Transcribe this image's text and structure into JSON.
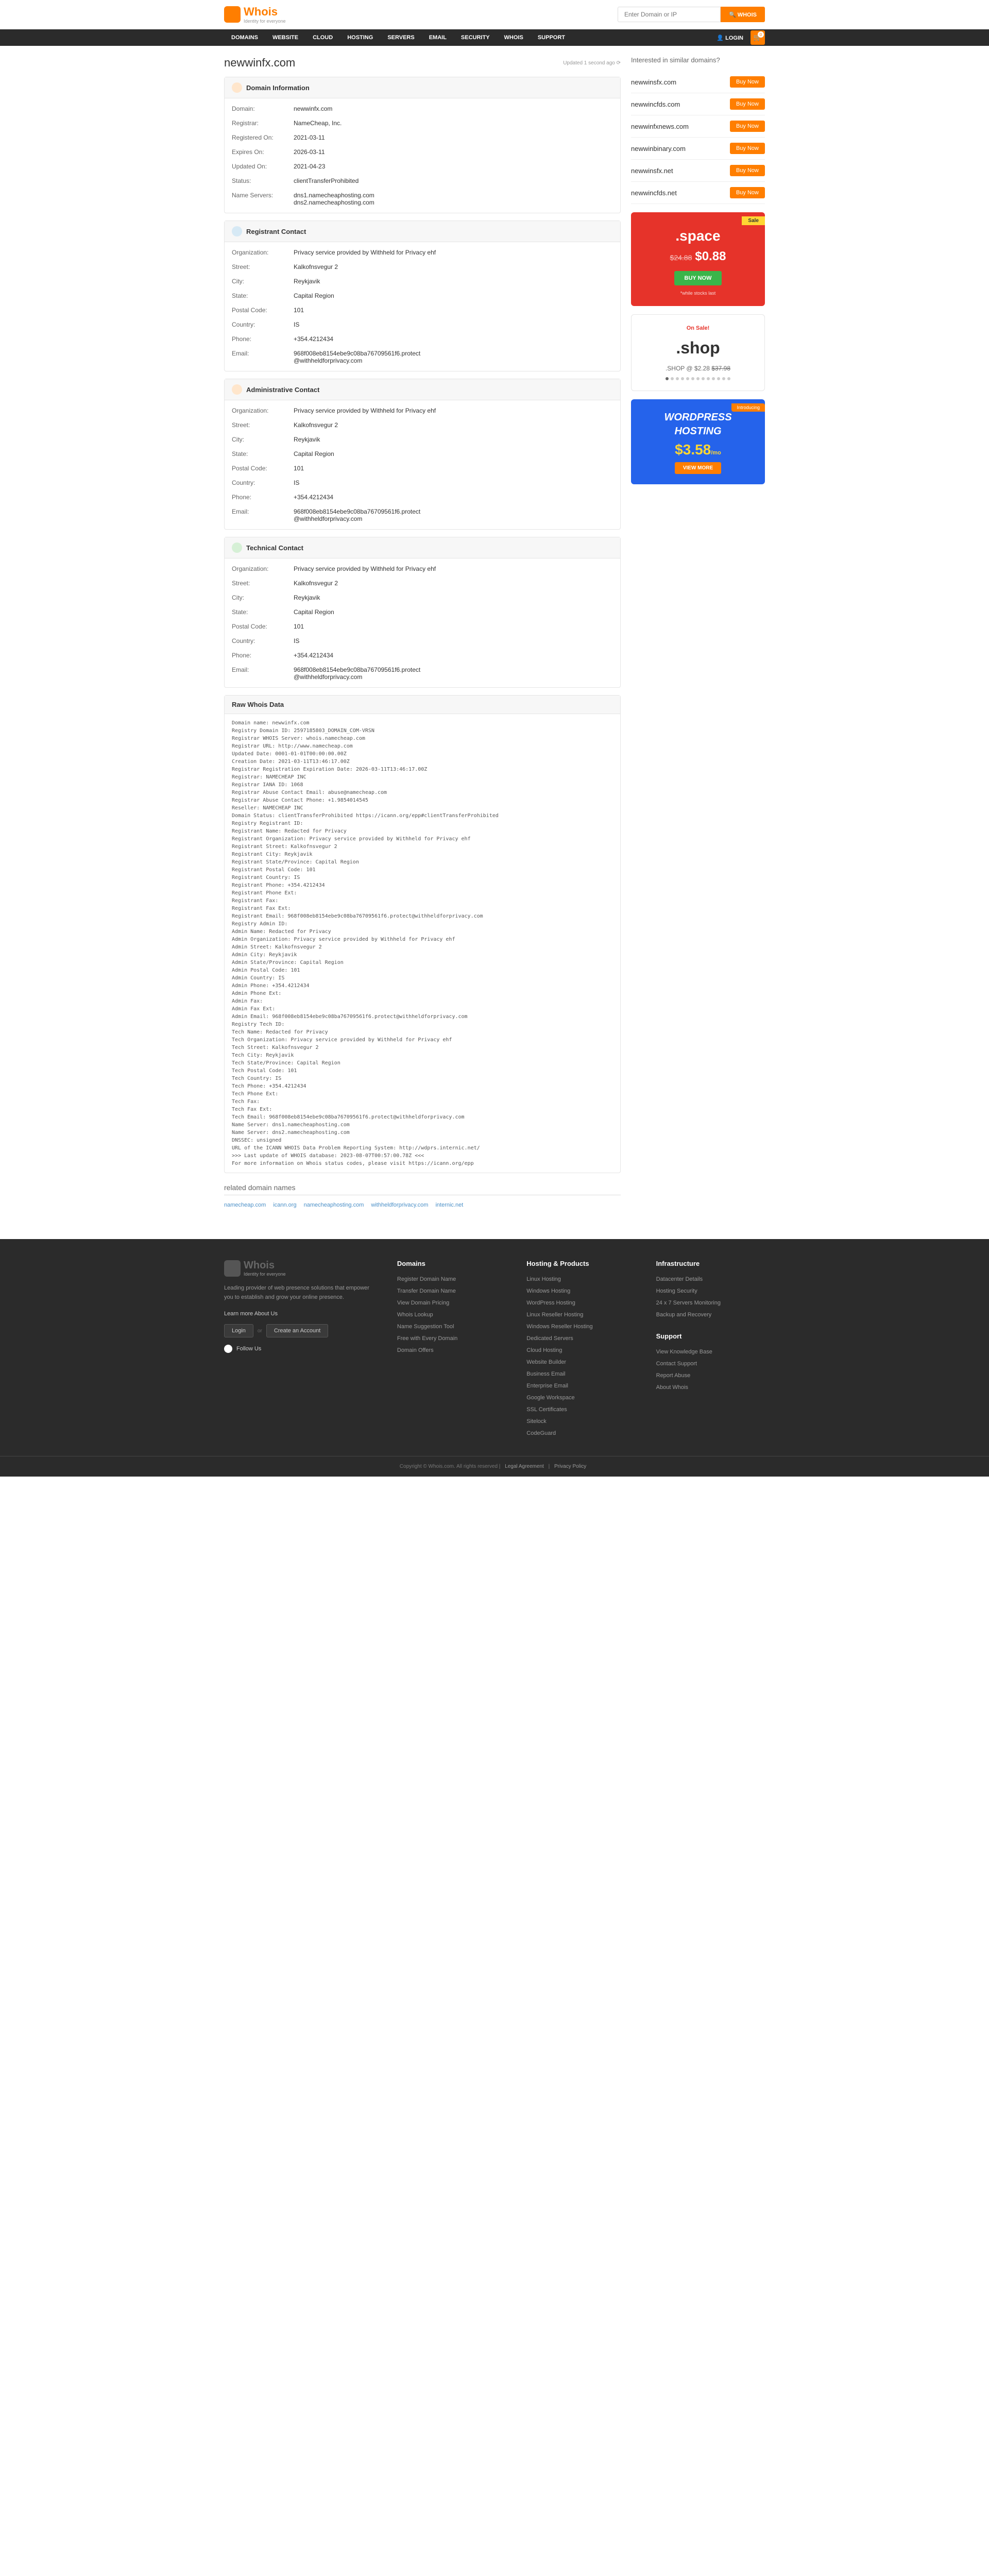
{
  "brand": {
    "name": "Whois",
    "tagline": "Identity for everyone"
  },
  "search": {
    "placeholder": "Enter Domain or IP",
    "button": "🔍 WHOIS"
  },
  "nav": [
    "DOMAINS",
    "WEBSITE",
    "CLOUD",
    "HOSTING",
    "SERVERS",
    "EMAIL",
    "SECURITY",
    "WHOIS",
    "SUPPORT"
  ],
  "login": "LOGIN",
  "cart_count": "0",
  "page_title": "newwinfx.com",
  "updated": "Updated 1 second ago ⟳",
  "sections": {
    "domain_info": {
      "title": "Domain Information",
      "rows": [
        {
          "label": "Domain:",
          "value": "newwinfx.com"
        },
        {
          "label": "Registrar:",
          "value": "NameCheap, Inc."
        },
        {
          "label": "Registered On:",
          "value": "2021-03-11"
        },
        {
          "label": "Expires On:",
          "value": "2026-03-11"
        },
        {
          "label": "Updated On:",
          "value": "2021-04-23"
        },
        {
          "label": "Status:",
          "value": "clientTransferProhibited"
        },
        {
          "label": "Name Servers:",
          "value": "dns1.namecheaphosting.com\ndns2.namecheaphosting.com"
        }
      ]
    },
    "registrant": {
      "title": "Registrant Contact",
      "rows": [
        {
          "label": "Organization:",
          "value": "Privacy service provided by Withheld for Privacy ehf"
        },
        {
          "label": "Street:",
          "value": "Kalkofnsvegur 2"
        },
        {
          "label": "City:",
          "value": "Reykjavik"
        },
        {
          "label": "State:",
          "value": "Capital Region"
        },
        {
          "label": "Postal Code:",
          "value": "101"
        },
        {
          "label": "Country:",
          "value": "IS"
        },
        {
          "label": "Phone:",
          "value": "+354.4212434"
        },
        {
          "label": "Email:",
          "value": "968f008eb8154ebe9c08ba76709561f6.protect\n@withheldforprivacy.com"
        }
      ]
    },
    "admin": {
      "title": "Administrative Contact",
      "rows": [
        {
          "label": "Organization:",
          "value": "Privacy service provided by Withheld for Privacy ehf"
        },
        {
          "label": "Street:",
          "value": "Kalkofnsvegur 2"
        },
        {
          "label": "City:",
          "value": "Reykjavik"
        },
        {
          "label": "State:",
          "value": "Capital Region"
        },
        {
          "label": "Postal Code:",
          "value": "101"
        },
        {
          "label": "Country:",
          "value": "IS"
        },
        {
          "label": "Phone:",
          "value": "+354.4212434"
        },
        {
          "label": "Email:",
          "value": "968f008eb8154ebe9c08ba76709561f6.protect\n@withheldforprivacy.com"
        }
      ]
    },
    "tech": {
      "title": "Technical Contact",
      "rows": [
        {
          "label": "Organization:",
          "value": "Privacy service provided by Withheld for Privacy ehf"
        },
        {
          "label": "Street:",
          "value": "Kalkofnsvegur 2"
        },
        {
          "label": "City:",
          "value": "Reykjavik"
        },
        {
          "label": "State:",
          "value": "Capital Region"
        },
        {
          "label": "Postal Code:",
          "value": "101"
        },
        {
          "label": "Country:",
          "value": "IS"
        },
        {
          "label": "Phone:",
          "value": "+354.4212434"
        },
        {
          "label": "Email:",
          "value": "968f008eb8154ebe9c08ba76709561f6.protect\n@withheldforprivacy.com"
        }
      ]
    },
    "raw": {
      "title": "Raw Whois Data",
      "text": "Domain name: newwinfx.com\nRegistry Domain ID: 2597185803_DOMAIN_COM-VRSN\nRegistrar WHOIS Server: whois.namecheap.com\nRegistrar URL: http://www.namecheap.com\nUpdated Date: 0001-01-01T00:00:00.00Z\nCreation Date: 2021-03-11T13:46:17.00Z\nRegistrar Registration Expiration Date: 2026-03-11T13:46:17.00Z\nRegistrar: NAMECHEAP INC\nRegistrar IANA ID: 1068\nRegistrar Abuse Contact Email: abuse@namecheap.com\nRegistrar Abuse Contact Phone: +1.9854014545\nReseller: NAMECHEAP INC\nDomain Status: clientTransferProhibited https://icann.org/epp#clientTransferProhibited\nRegistry Registrant ID:\nRegistrant Name: Redacted for Privacy\nRegistrant Organization: Privacy service provided by Withheld for Privacy ehf\nRegistrant Street: Kalkofnsvegur 2\nRegistrant City: Reykjavik\nRegistrant State/Province: Capital Region\nRegistrant Postal Code: 101\nRegistrant Country: IS\nRegistrant Phone: +354.4212434\nRegistrant Phone Ext:\nRegistrant Fax:\nRegistrant Fax Ext:\nRegistrant Email: 968f008eb8154ebe9c08ba76709561f6.protect@withheldforprivacy.com\nRegistry Admin ID:\nAdmin Name: Redacted for Privacy\nAdmin Organization: Privacy service provided by Withheld for Privacy ehf\nAdmin Street: Kalkofnsvegur 2\nAdmin City: Reykjavik\nAdmin State/Province: Capital Region\nAdmin Postal Code: 101\nAdmin Country: IS\nAdmin Phone: +354.4212434\nAdmin Phone Ext:\nAdmin Fax:\nAdmin Fax Ext:\nAdmin Email: 968f008eb8154ebe9c08ba76709561f6.protect@withheldforprivacy.com\nRegistry Tech ID:\nTech Name: Redacted for Privacy\nTech Organization: Privacy service provided by Withheld for Privacy ehf\nTech Street: Kalkofnsvegur 2\nTech City: Reykjavik\nTech State/Province: Capital Region\nTech Postal Code: 101\nTech Country: IS\nTech Phone: +354.4212434\nTech Phone Ext:\nTech Fax:\nTech Fax Ext:\nTech Email: 968f008eb8154ebe9c08ba76709561f6.protect@withheldforprivacy.com\nName Server: dns1.namecheaphosting.com\nName Server: dns2.namecheaphosting.com\nDNSSEC: unsigned\nURL of the ICANN WHOIS Data Problem Reporting System: http://wdprs.internic.net/\n>>> Last update of WHOIS database: 2023-08-07T00:57:00.78Z <<<\nFor more information on Whois status codes, please visit https://icann.org/epp"
    }
  },
  "related": {
    "title": "related domain names",
    "links": [
      "namecheap.com",
      "icann.org",
      "namecheaphosting.com",
      "withheldforprivacy.com",
      "internic.net"
    ]
  },
  "similar": {
    "title": "Interested in similar domains?",
    "buy": "Buy Now",
    "items": [
      "newwinsfx.com",
      "newwincfds.com",
      "newwinfxnews.com",
      "newwinbinary.com",
      "newwinsfx.net",
      "newwincfds.net"
    ]
  },
  "promo_space": {
    "sale": "Sale",
    "tld": ".space",
    "old": "$24.88",
    "new": "$0.88",
    "btn": "BUY NOW",
    "note": "*while stocks last"
  },
  "promo_shop": {
    "onsale": "On Sale!",
    "logo": ".shop",
    "text": ".SHOP @ $2.28 ",
    "old": "$37.98"
  },
  "promo_wp": {
    "tag": "Introducing",
    "line1": "WORDPRESS",
    "line2": "HOSTING",
    "price": "$3.58",
    "per": "/mo",
    "btn": "VIEW MORE"
  },
  "footer": {
    "about": "Leading provider of web presence solutions that empower you to establish and grow your online presence.",
    "learn": "Learn more About Us",
    "login": "Login",
    "or": "or",
    "create": "Create an Account",
    "follow": "Follow Us",
    "cols": [
      {
        "title": "Domains",
        "links": [
          "Register Domain Name",
          "Transfer Domain Name",
          "View Domain Pricing",
          "Whois Lookup",
          "Name Suggestion Tool",
          "Free with Every Domain",
          "Domain Offers"
        ]
      },
      {
        "title": "Hosting & Products",
        "links": [
          "Linux Hosting",
          "Windows Hosting",
          "WordPress Hosting",
          "Linux Reseller Hosting",
          "Windows Reseller Hosting",
          "Dedicated Servers",
          "Cloud Hosting",
          "Website Builder",
          "Business Email",
          "Enterprise Email",
          "Google Workspace",
          "SSL Certificates",
          "Sitelock",
          "CodeGuard"
        ]
      },
      {
        "title": "Infrastructure",
        "links": [
          "Datacenter Details",
          "Hosting Security",
          "24 x 7 Servers Monitoring",
          "Backup and Recovery"
        ]
      },
      {
        "title": "Support",
        "links": [
          "View Knowledge Base",
          "Contact Support",
          "Report Abuse",
          "About Whois"
        ]
      }
    ],
    "copyright": "Copyright © Whois.com. All rights reserved",
    "legal": "Legal Agreement",
    "privacy": "Privacy Policy"
  }
}
